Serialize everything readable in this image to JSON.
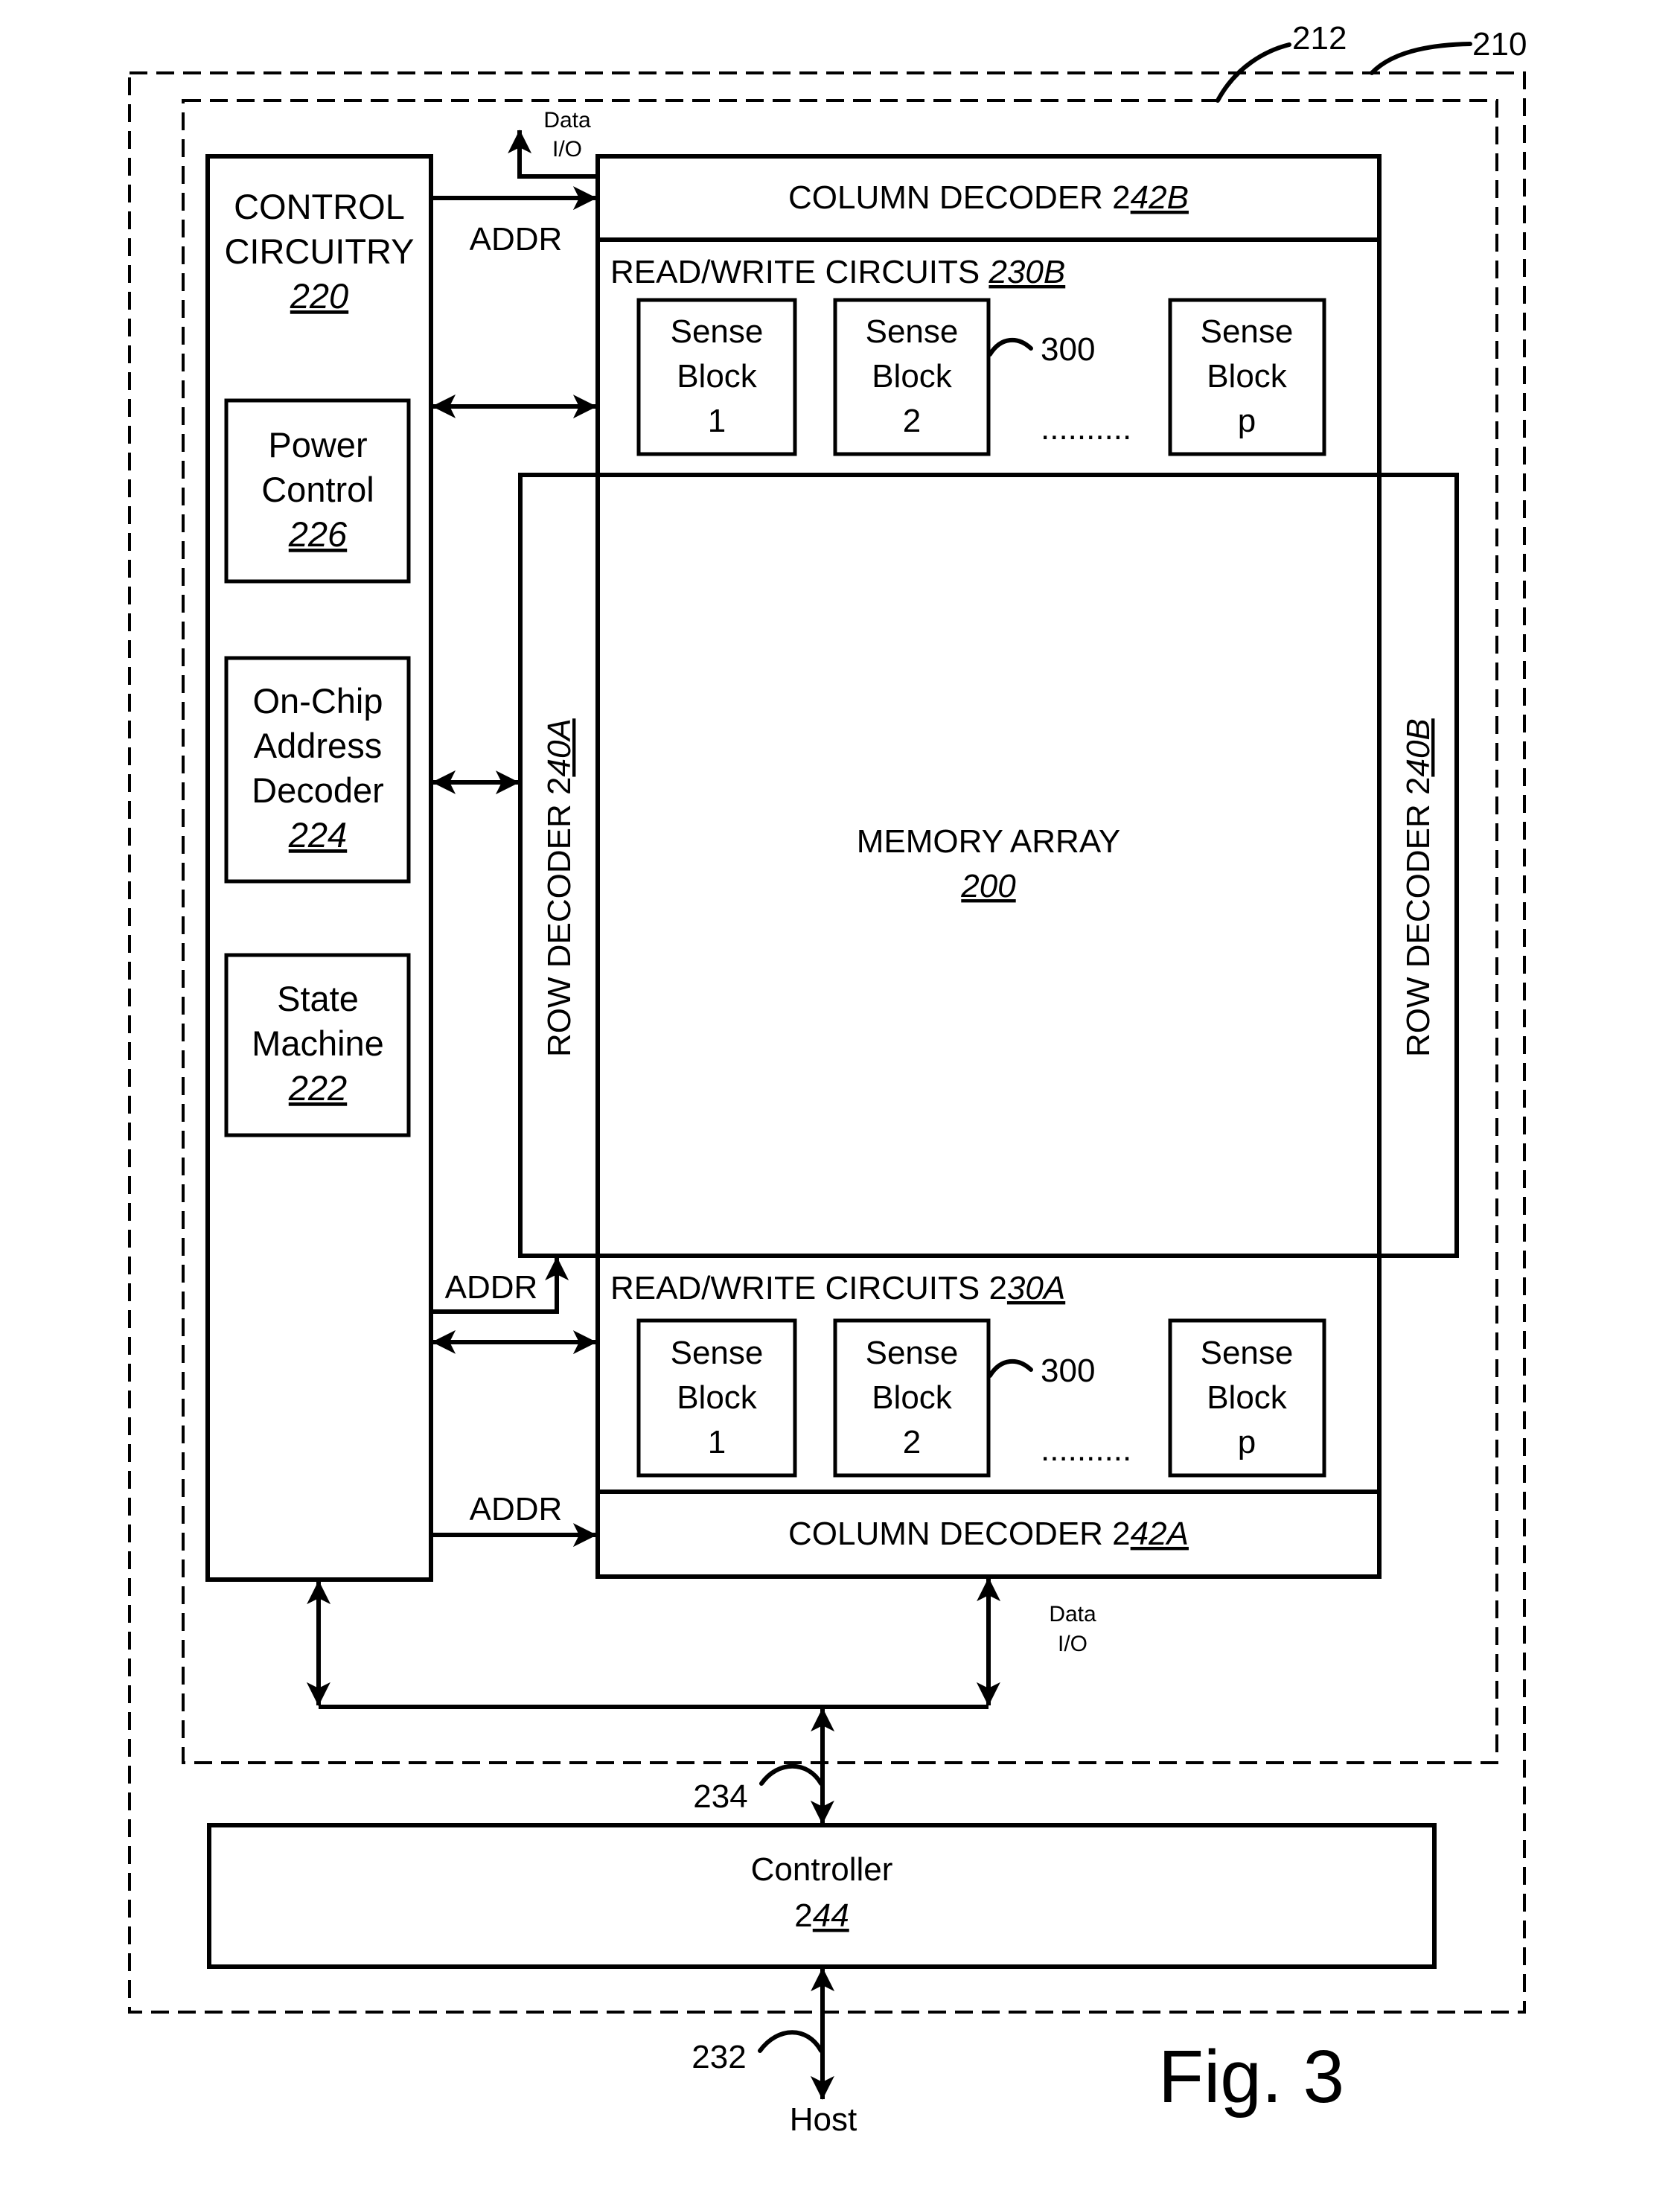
{
  "figure": {
    "label": "Fig. 3",
    "ref_outer": "210",
    "ref_inner": "212"
  },
  "control_circuitry": {
    "line1": "CONTROL",
    "line2": "CIRCUITRY",
    "ref": "220",
    "power_control": {
      "line1": "Power",
      "line2": "Control",
      "ref": "226"
    },
    "address_decoder": {
      "line1": "On-Chip",
      "line2": "Address",
      "line3": "Decoder",
      "ref": "224"
    },
    "state_machine": {
      "line1": "State",
      "line2": "Machine",
      "ref": "222"
    }
  },
  "column_decoder_b": {
    "label": "COLUMN DECODER 2",
    "ref": "42B"
  },
  "column_decoder_a": {
    "label": "COLUMN DECODER 2",
    "ref": "42A"
  },
  "rw_circuits_b": {
    "label": "READ/WRITE CIRCUITS ",
    "ref": "230B"
  },
  "rw_circuits_a": {
    "label": "READ/WRITE CIRCUITS 2",
    "ref": "30A"
  },
  "sense_blocks": [
    {
      "line1": "Sense",
      "line2": "Block",
      "line3": "1"
    },
    {
      "line1": "Sense",
      "line2": "Block",
      "line3": "2"
    },
    {
      "line1": "Sense",
      "line2": "Block",
      "line3": "p"
    }
  ],
  "sense_ref": "300",
  "ellipsis": "..........",
  "memory_array": {
    "label": "MEMORY ARRAY",
    "ref": "200"
  },
  "row_decoder_a": {
    "label": "ROW DECODER 2",
    "ref": "40A"
  },
  "row_decoder_b": {
    "label": "ROW DECODER 2",
    "ref": "40B"
  },
  "signals": {
    "addr": "ADDR",
    "data_line1": "Data",
    "data_line2": "I/O"
  },
  "controller": {
    "label": "Controller",
    "prefix": "2",
    "ref": "44"
  },
  "bus_ref_234": "234",
  "bus_ref_232": "232",
  "host": "Host"
}
